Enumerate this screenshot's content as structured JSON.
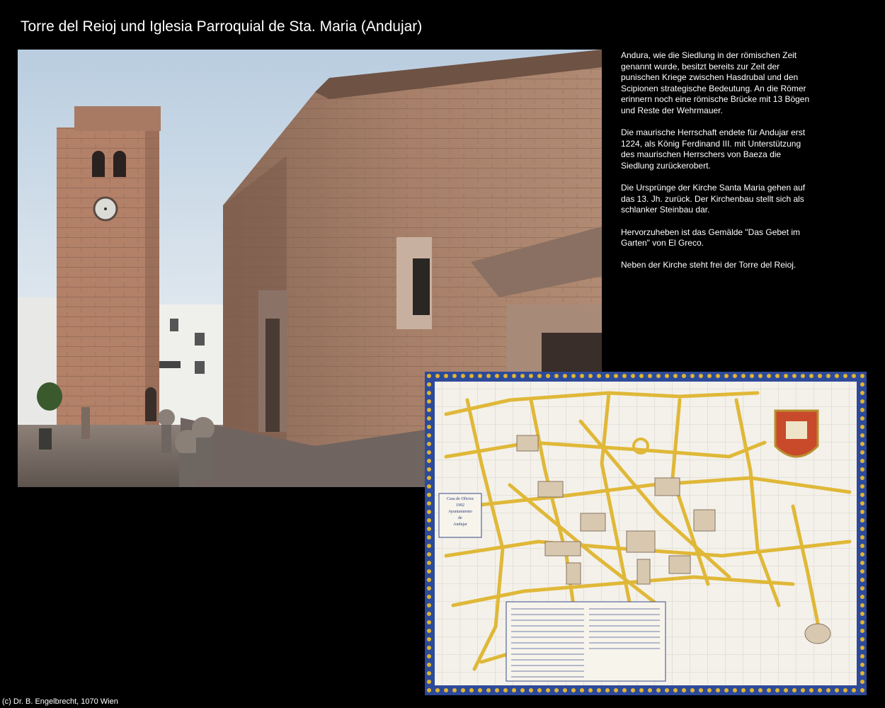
{
  "title": "Torre del Reioj und Iglesia Parroquial de Sta. Maria (Andujar)",
  "paragraphs": [
    "Andura, wie die Siedlung in der römischen Zeit genannt wurde, besitzt bereits zur Zeit der punischen Kriege zwischen Hasdrubal und den Scipionen strategische Bedeutung. An die Römer erinnern noch eine römische Brücke mit 13 Bögen und Reste der Wehrmauer.",
    "Die maurische Herrschaft endete für Andujar erst 1224, als König Ferdinand III. mit Unterstützung des maurischen Herrschers von Baeza die Siedlung zurückerobert.",
    "Die Ursprünge der Kirche Santa Maria gehen auf das 13. Jh. zurück. Der Kirchenbau stellt sich als schlanker Steinbau dar.",
    "Hervorzuheben ist das Gemälde \"Das Gebet im Garten\" von El Greco.",
    "Neben der Kirche steht frei der Torre del Reioj."
  ],
  "map_plaque": {
    "line1": "Casa de Oficios",
    "line2": "1992",
    "line3": "Ayuntamiento",
    "line4": "de",
    "line5": "Andujar"
  },
  "copyright": "(c) Dr. B. Engelbrecht, 1070 Wien"
}
